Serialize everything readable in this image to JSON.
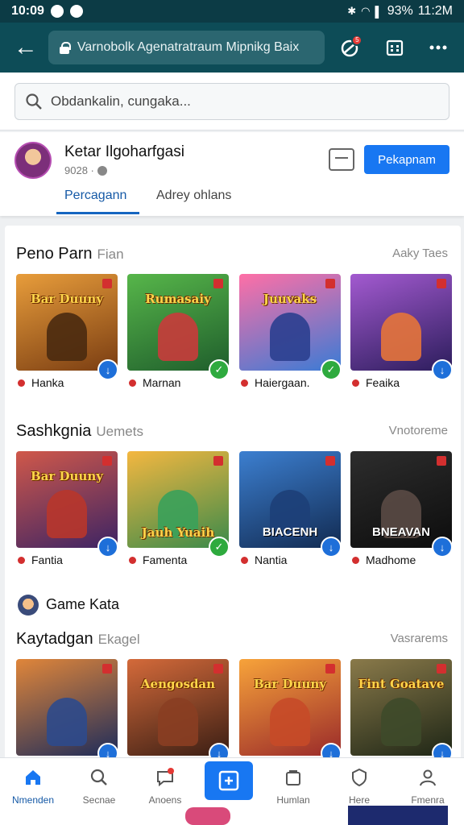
{
  "status_bar": {
    "time": "10:09",
    "battery": "93%",
    "clock_right": "11:2M"
  },
  "browser": {
    "url": "Varnobolk Agenatratraum Mipnikg Baix",
    "notification_count": "5"
  },
  "search": {
    "placeholder": "Obdankalin, cungaka..."
  },
  "profile": {
    "name": "Ketar Ilgoharfgasi",
    "subtitle": "9028 ·",
    "primary_button": "Pekapnam",
    "tabs": [
      {
        "label": "Percagann",
        "active": true
      },
      {
        "label": "Adrey ohlans",
        "active": false
      }
    ]
  },
  "sections": [
    {
      "title": "Peno Parn",
      "subtitle": "Fian",
      "more": "Aaky Taes",
      "games": [
        {
          "title": "Bar Duuny",
          "caption": "Hanka",
          "check": "blue",
          "art": [
            "#e89d3b",
            "#7a3d12"
          ],
          "figure": "#4a2a10"
        },
        {
          "title": "Rumasaiy",
          "caption": "Marnan",
          "check": "green",
          "art": [
            "#57b64a",
            "#1f5e2c"
          ],
          "figure": "#c93b3b"
        },
        {
          "title": "Juuvaks",
          "caption": "Haiergaan.",
          "check": "green",
          "art": [
            "#ff6fa6",
            "#3a7bd5"
          ],
          "figure": "#2b3f8f"
        },
        {
          "title": "",
          "caption": "Feaika",
          "check": "blue",
          "art": [
            "#a35ad0",
            "#2c1d5c"
          ],
          "figure": "#e6743a"
        }
      ]
    },
    {
      "title": "Sashkgnia",
      "subtitle": "Uemets",
      "more": "Vnotoreme",
      "games": [
        {
          "title": "Bar Duuny",
          "caption": "Fantia",
          "check": "blue",
          "art": [
            "#d0584a",
            "#3d2464"
          ],
          "figure": "#b8362b"
        },
        {
          "title": "Jauh Yuaih",
          "caption": "Famenta",
          "check": "green",
          "art": [
            "#f4b740",
            "#3b8a4a"
          ],
          "figure": "#3aa15a"
        },
        {
          "title": "BIACENH",
          "caption": "Nantia",
          "check": "blue",
          "art": [
            "#3c7fd0",
            "#122b52"
          ],
          "figure": "#1d3f78"
        },
        {
          "title": "BNEAVAN",
          "caption": "Madhome",
          "check": "blue",
          "art": [
            "#2d2d2d",
            "#0d0d0d"
          ],
          "figure": "#5a4a45"
        }
      ]
    },
    {
      "header": "Game Kata",
      "title": "Kaytadgan",
      "subtitle": "Ekagel",
      "more": "Vasrarems",
      "games": [
        {
          "title": "",
          "art": [
            "#e0863a",
            "#1e2c5a"
          ],
          "figure": "#2e4a8c",
          "check": "blue"
        },
        {
          "title": "Aengosdan",
          "art": [
            "#d46a3a",
            "#3a1e14"
          ],
          "figure": "#8a3e22",
          "check": "blue"
        },
        {
          "title": "Bar Duuny",
          "art": [
            "#f7a33a",
            "#9a2a2a"
          ],
          "figure": "#c74a28",
          "check": "blue"
        },
        {
          "title": "Fint Goatave",
          "art": [
            "#8a7a4a",
            "#1e2616"
          ],
          "figure": "#3e4a2a",
          "check": "blue"
        }
      ]
    }
  ],
  "bottom_nav": [
    {
      "label": "Nmenden",
      "icon": "home-icon",
      "active": true
    },
    {
      "label": "Secnae",
      "icon": "search-icon"
    },
    {
      "label": "Anoens",
      "icon": "chat-icon"
    },
    {
      "label": "",
      "icon": "create-icon"
    },
    {
      "label": "Humlan",
      "icon": "store-icon"
    },
    {
      "label": "Here",
      "icon": "shield-icon"
    },
    {
      "label": "Fmenra",
      "icon": "profile-icon"
    }
  ],
  "colors": {
    "brand": "#1877f2",
    "topbar": "#0d4c57",
    "statusbar": "#0c3b45"
  }
}
